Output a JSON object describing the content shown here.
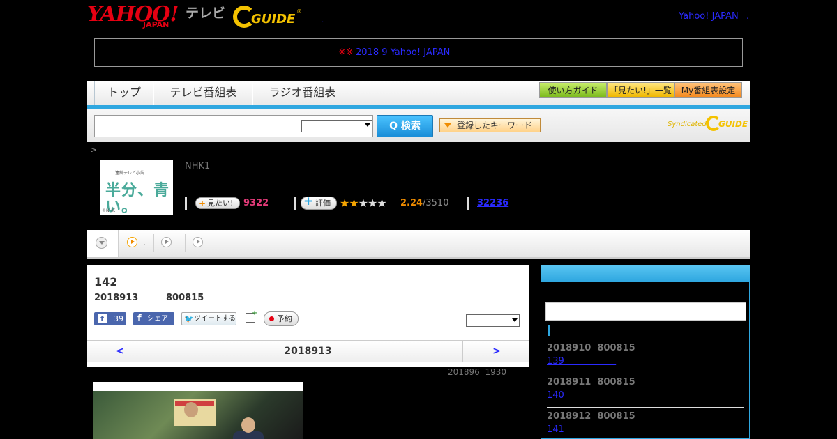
{
  "header": {
    "yahoo_logo_main": "YAHOO!",
    "yahoo_logo_sub": "JAPAN",
    "tv_label": "テレビ",
    "gguide_logo_text": "GUIDE",
    "gguide_reg": "®",
    "header_dot": ".",
    "yahoo_japan_link": "Yahoo! JAPAN",
    "header_link_dot": "."
  },
  "notice": {
    "marks": "※※",
    "link_text": "2018 9 Yahoo! JAPAN                  "
  },
  "nav": {
    "tabs": [
      {
        "label": "トップ"
      },
      {
        "label": "テレビ番組表"
      },
      {
        "label": "ラジオ番組表"
      }
    ],
    "buttons": {
      "guide": "使い方ガイド",
      "mitai_list": "「見たい!」一覧",
      "my_settings": "My番組表設定"
    }
  },
  "search": {
    "input_value": "",
    "button_label": "Q 検索",
    "keyword_button": "登録したキーワード",
    "syndicated": "Syndicated",
    "syndicated_logo": "GUIDE"
  },
  "breadcrumb": ">",
  "program": {
    "thumb_title": "半分、青い。",
    "thumb_sub": "連続テレビ小説",
    "thumb_copyright": "©NHK",
    "channel": "NHK1",
    "mitai_label": "見たい!",
    "mitai_plus": "+",
    "mitai_count": "9322",
    "eval_label": "評価",
    "eval_plus": "+",
    "eval_stars_on": "★★",
    "eval_stars_off": "★★★",
    "rating": 2.24,
    "eval_score": "2.24",
    "eval_total": "/3510",
    "comments_count": "32236"
  },
  "tabs": {
    "items": [
      {
        "label": ""
      },
      {
        "label": "."
      },
      {
        "label": ""
      },
      {
        "label": ""
      }
    ]
  },
  "episode": {
    "number": "142",
    "date": "2018913",
    "time": "800815",
    "fb_like_icon": "f",
    "fb_like_count": "39",
    "fb_share_icon": "f",
    "fb_share": "シェア",
    "tweet_icon": "🐦",
    "tweet": "ツイートする",
    "calendar_plus": "+",
    "reserve": "予約",
    "prev_day": "<",
    "current_day": "2018913",
    "next_day": ">",
    "update_note": "201896  1930"
  },
  "sidebar": {
    "items": [
      {
        "date": "2018910  800815",
        "link": "139                  "
      },
      {
        "date": "2018911  800815",
        "link": "140                  "
      },
      {
        "date": "2018912  800815",
        "link": "141                  "
      }
    ]
  },
  "colors": {
    "brand_red": "#e60012",
    "accent_blue": "#2fa7e0",
    "gguide_yellow": "#f4c200",
    "link_blue": "#2a2aff"
  }
}
